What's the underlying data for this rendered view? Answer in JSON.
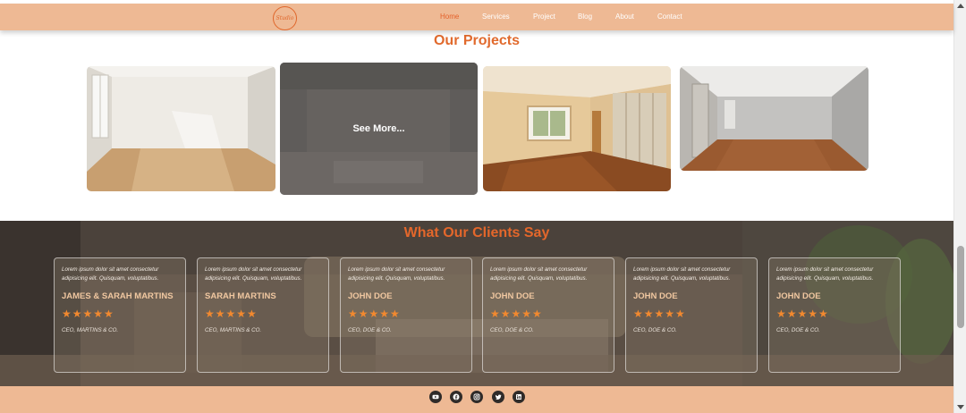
{
  "nav": {
    "logo_text": "Studio",
    "items": [
      {
        "label": "Home",
        "active": true
      },
      {
        "label": "Services",
        "active": false
      },
      {
        "label": "Project",
        "active": false
      },
      {
        "label": "Blog",
        "active": false
      },
      {
        "label": "About",
        "active": false
      },
      {
        "label": "Contact",
        "active": false
      }
    ]
  },
  "projects": {
    "title": "Our Projects",
    "see_more": "See More..."
  },
  "testimonials": {
    "title": "What Our Clients Say",
    "cards": [
      {
        "quote": "Lorem ipsum dolor sit amet consectetur adipisicing elit. Quisquam, voluptatibus.",
        "name": "JAMES & SARAH MARTINS",
        "stars": "★★★★★",
        "rating": 5,
        "role": "CEO, MARTINS & CO."
      },
      {
        "quote": "Lorem ipsum dolor sit amet consectetur adipisicing elit. Quisquam, voluptatibus.",
        "name": "SARAH MARTINS",
        "stars": "★★★★★",
        "rating": 5,
        "role": "CEO, MARTINS & CO."
      },
      {
        "quote": "Lorem ipsum dolor sit amet consectetur adipisicing elit. Quisquam, voluptatibus.",
        "name": "JOHN DOE",
        "stars": "★★★★★",
        "rating": 5,
        "role": "CEO, DOE & CO."
      },
      {
        "quote": "Lorem ipsum dolor sit amet consectetur adipisicing elit. Quisquam, voluptatibus.",
        "name": "JOHN DOE",
        "stars": "★★★★★",
        "rating": 5,
        "role": "CEO, DOE & CO."
      },
      {
        "quote": "Lorem ipsum dolor sit amet consectetur adipisicing elit. Quisquam, voluptatibus.",
        "name": "JOHN DOE",
        "stars": "★★★★★",
        "rating": 5,
        "role": "CEO, DOE & CO."
      },
      {
        "quote": "Lorem ipsum dolor sit amet consectetur adipisicing elit. Quisquam, voluptatibus.",
        "name": "JOHN DOE",
        "stars": "★★★★★",
        "rating": 5,
        "role": "CEO, DOE & CO."
      }
    ]
  },
  "footer": {
    "social_icons": [
      "youtube-icon",
      "facebook-icon",
      "instagram-icon",
      "twitter-icon",
      "linkedin-icon"
    ]
  },
  "colors": {
    "accent": "#e16a2d",
    "nav_bg": "#eeb994",
    "star": "#f2892f",
    "social_bg": "#2f2b29"
  }
}
